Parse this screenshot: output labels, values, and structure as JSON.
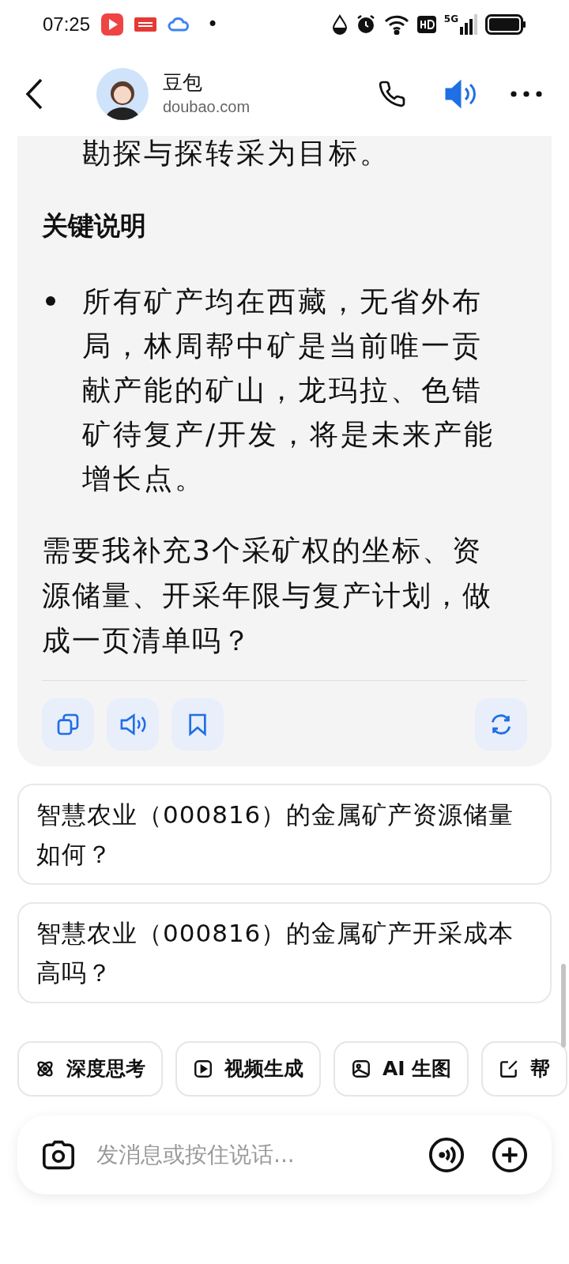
{
  "status_bar": {
    "time": "07:25",
    "notification_dot": "•",
    "network": "5G"
  },
  "header": {
    "name": "豆包",
    "subtitle": "doubao.com",
    "speaker_on": true
  },
  "message": {
    "continued_line": "勘探与探转采为目标。",
    "heading": "关键说明",
    "bullets": [
      "所有矿产均在西藏，无省外布局，林周帮中矿是当前唯一贡献产能的矿山，龙玛拉、色错矿待复产/开发，将是未来产能增长点。"
    ],
    "closing": "需要我补充3个采矿权的坐标、资源储量、开采年限与复产计划，做成一页清单吗？"
  },
  "suggestions": [
    "智慧农业（000816）的金属矿产资源储量如何？",
    "智慧农业（000816）的金属矿产开采成本高吗？"
  ],
  "tools": [
    {
      "kind": "think",
      "label": "深度思考"
    },
    {
      "kind": "video",
      "label": "视频生成"
    },
    {
      "kind": "image",
      "label": "AI 生图"
    },
    {
      "kind": "write",
      "label": "帮"
    }
  ],
  "input": {
    "placeholder": "发消息或按住说话..."
  }
}
